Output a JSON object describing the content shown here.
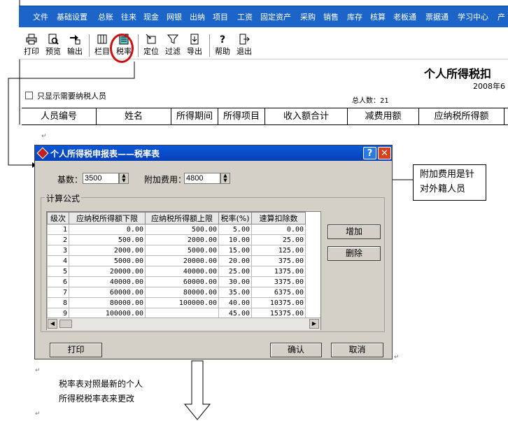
{
  "menu": [
    "文件",
    "基础设置",
    "总账",
    "往来",
    "现金",
    "网银",
    "出纳",
    "项目",
    "工资",
    "固定资产",
    "采购",
    "销售",
    "库存",
    "核算",
    "老板通",
    "票据通",
    "学习中心",
    "产"
  ],
  "toolbar": [
    {
      "label": "打印",
      "icon": "printer-icon"
    },
    {
      "label": "预览",
      "icon": "preview-icon"
    },
    {
      "label": "输出",
      "icon": "export-icon"
    },
    {
      "label": "栏目",
      "icon": "columns-icon"
    },
    {
      "label": "税率",
      "icon": "tax-rate-icon"
    },
    {
      "label": "定位",
      "icon": "locate-icon"
    },
    {
      "label": "过滤",
      "icon": "filter-icon"
    },
    {
      "label": "导出",
      "icon": "export-out-icon"
    },
    {
      "label": "帮助",
      "icon": "help-icon"
    },
    {
      "label": "退出",
      "icon": "exit-icon"
    }
  ],
  "report": {
    "title": "个人所得税扣",
    "date": "2008年6",
    "only_need_label": "只显示需要纳税人员",
    "total_people": "总人数：21",
    "columns": [
      "人员编号",
      "姓名",
      "所得期间",
      "所得项目",
      "收入额合计",
      "减费用额",
      "应纳税所得额"
    ]
  },
  "dialog": {
    "title": "个人所得税申报表——税率表",
    "help_btn": "?",
    "close_btn": "✕",
    "base_label": "基数：",
    "base_value": "3500",
    "extra_label": "附加费用：",
    "extra_value": "4800",
    "group_title": "计算公式",
    "headers": [
      "级次",
      "应纳税所得额下限",
      "应纳税所得额上限",
      "税率(%)",
      "速算扣除数"
    ],
    "rows": [
      [
        "1",
        "0.00",
        "500.00",
        "5.00",
        "0.00"
      ],
      [
        "2",
        "500.00",
        "2000.00",
        "10.00",
        "25.00"
      ],
      [
        "3",
        "2000.00",
        "5000.00",
        "15.00",
        "125.00"
      ],
      [
        "4",
        "5000.00",
        "20000.00",
        "20.00",
        "375.00"
      ],
      [
        "5",
        "20000.00",
        "40000.00",
        "25.00",
        "1375.00"
      ],
      [
        "6",
        "40000.00",
        "60000.00",
        "30.00",
        "3375.00"
      ],
      [
        "7",
        "60000.00",
        "80000.00",
        "35.00",
        "6375.00"
      ],
      [
        "8",
        "80000.00",
        "100000.00",
        "40.00",
        "10375.00"
      ],
      [
        "9",
        "100000.00",
        "",
        "45.00",
        "15375.00"
      ]
    ],
    "add_btn": "增加",
    "delete_btn": "删除",
    "print_btn": "打印",
    "ok_btn": "确认",
    "cancel_btn": "取消"
  },
  "annotations": {
    "callout_line1": "附加费用是针",
    "callout_line2": "对外籍人员",
    "note_line1": "税率表对照最新的个人",
    "note_line2": "所得税税率表来更改"
  },
  "colors": {
    "menubar": "#1c64c8",
    "titlebar": "#0a58d8",
    "highlight_circle": "#d01010",
    "dialog_bg": "#d4d0c8"
  }
}
